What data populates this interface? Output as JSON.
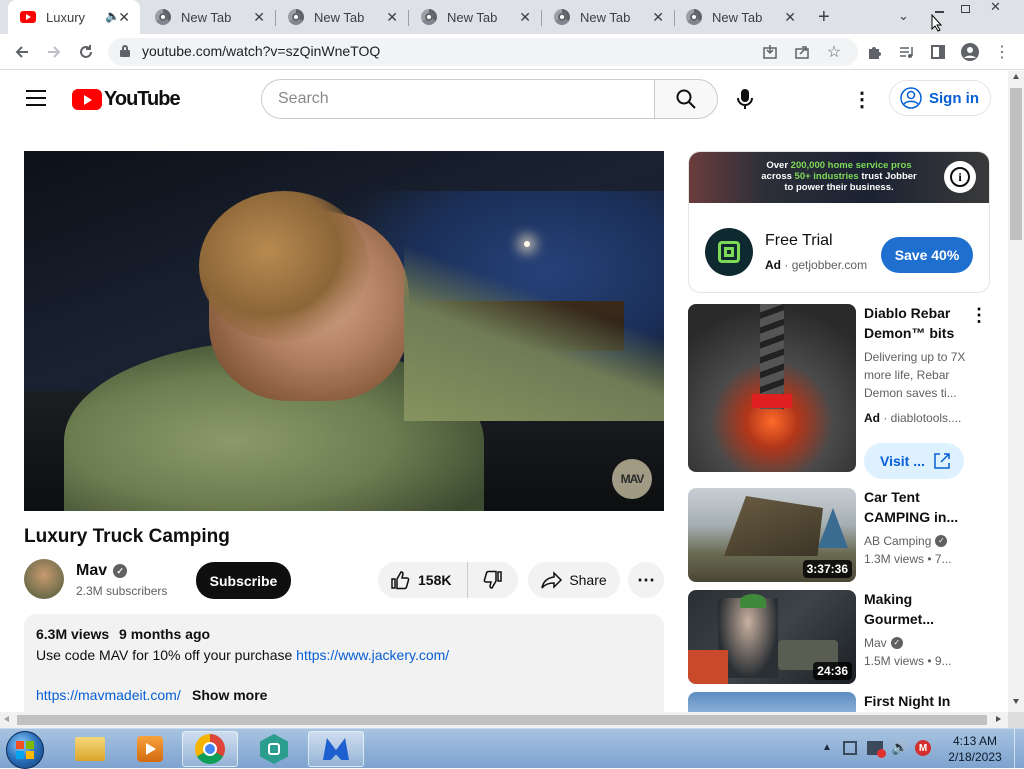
{
  "browser": {
    "tabs": [
      {
        "label": "Luxury T",
        "active": true
      },
      {
        "label": "New Tab"
      },
      {
        "label": "New Tab"
      },
      {
        "label": "New Tab"
      },
      {
        "label": "New Tab"
      },
      {
        "label": "New Tab"
      }
    ],
    "url": "youtube.com/watch?v=szQinWneTOQ"
  },
  "youtube": {
    "logo_text": "YouTube",
    "search_placeholder": "Search",
    "signin_label": "Sign in"
  },
  "video": {
    "title": "Luxury Truck Camping",
    "watermark": "MAV",
    "channel": {
      "name": "Mav",
      "subscribers": "2.3M subscribers"
    },
    "subscribe_label": "Subscribe",
    "likes": "158K",
    "share_label": "Share",
    "views": "6.3M views",
    "age": "9 months ago",
    "description_line1": "Use code MAV for 10% off your purchase ",
    "description_link1": "https://www.jackery.com/",
    "description_link2": "https://mavmadeit.com/",
    "show_more": "Show more"
  },
  "ad_banner": {
    "text_line1a": "Over ",
    "text_highlight1": "200,000 home service pros",
    "text_line2a": "across ",
    "text_highlight2": "50+ industries",
    "text_line2b": " trust Jobber",
    "text_line3": "to power their business.",
    "title": "Free Trial",
    "ad_label": "Ad",
    "domain": "getjobber.com",
    "cta": "Save 40%"
  },
  "sidebar": [
    {
      "title": "Diablo Rebar Demon™ bits",
      "desc": "Delivering up to 7X more life, Rebar Demon saves ti...",
      "ad_label": "Ad",
      "source": "diablotools....",
      "cta": "Visit ..."
    },
    {
      "title": "Car Tent CAMPING in...",
      "channel": "AB Camping",
      "meta": "1.3M views",
      "meta2": "7...",
      "duration": "3:37:36"
    },
    {
      "title": "Making Gourmet...",
      "channel": "Mav",
      "meta": "1.5M views",
      "meta2": "9...",
      "duration": "24:36"
    },
    {
      "title": "First Night In"
    }
  ],
  "taskbar": {
    "time": "4:13 AM",
    "date": "2/18/2023"
  },
  "colors": {
    "youtube_red": "#ff0000",
    "link_blue": "#065fd4",
    "save_button": "#1f6fd1",
    "subscribe_bg": "#0f0f0f"
  }
}
